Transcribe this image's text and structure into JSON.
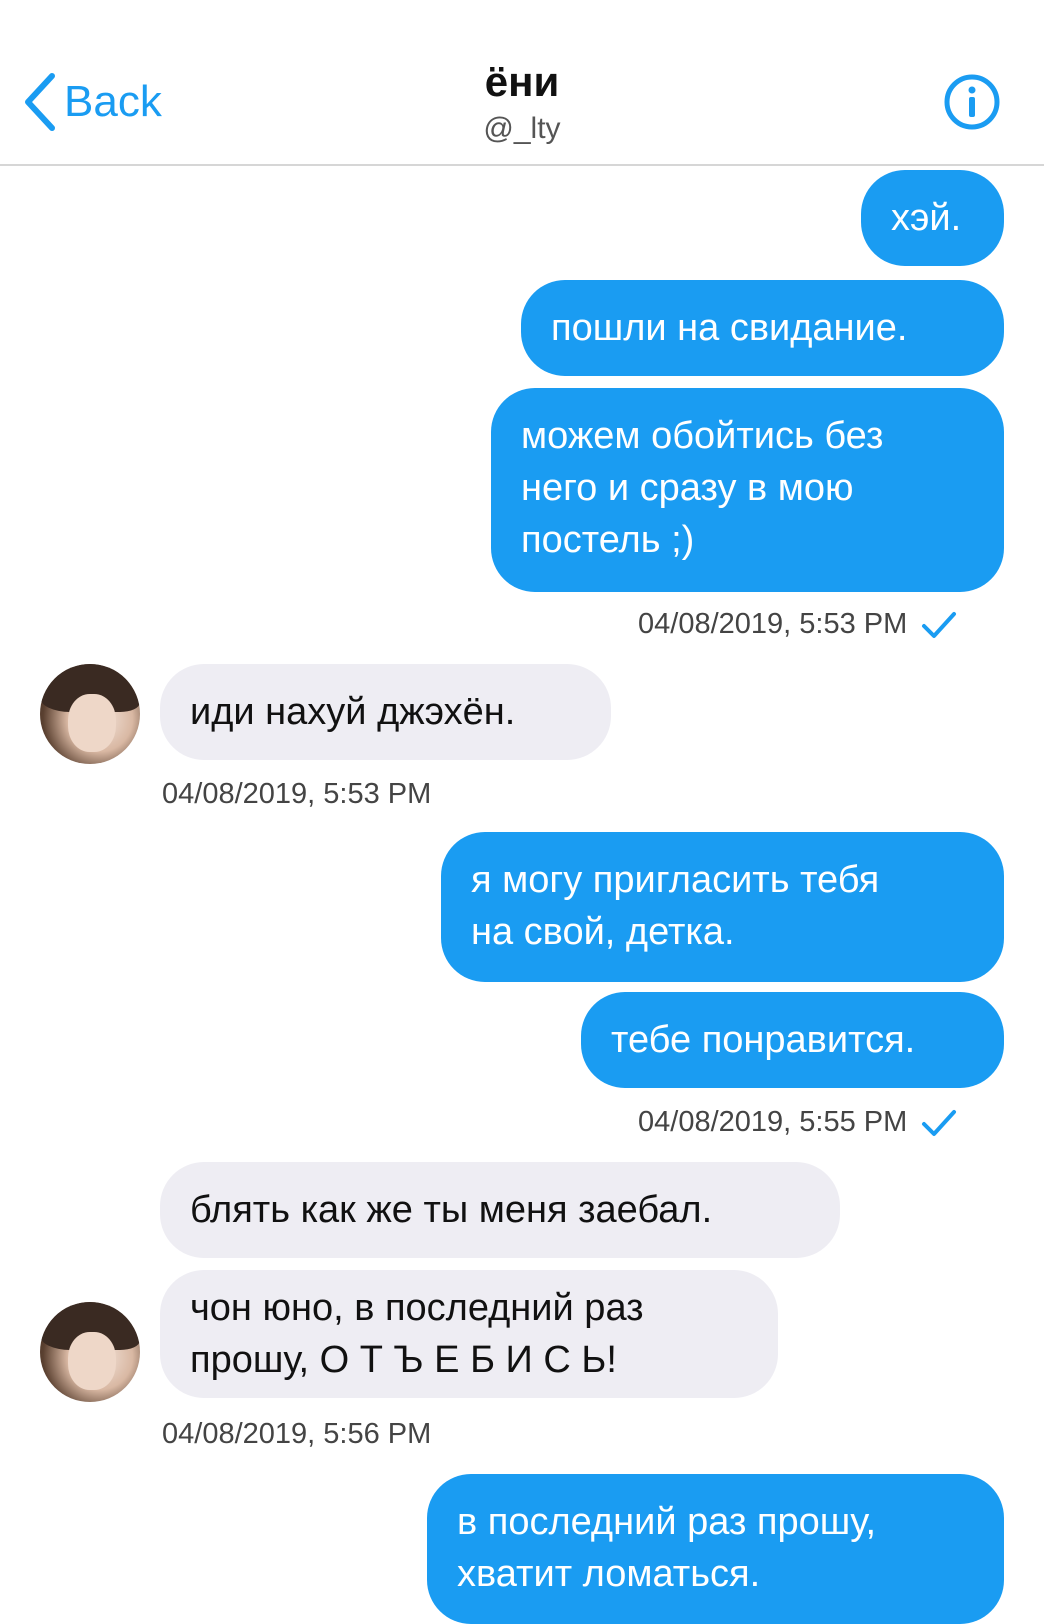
{
  "header": {
    "back_label": "Back",
    "name": "ёни",
    "handle": "@_lty",
    "info_icon": "info-icon"
  },
  "colors": {
    "accent": "#1a9cf2",
    "incoming_bubble": "#eeedf3",
    "outgoing_text": "#ffffff"
  },
  "messages": [
    {
      "text": "хэй."
    },
    {
      "text": "пошли на свидание."
    },
    {
      "text": "можем обойтись без\nнего и сразу в мою\nпостель ;)"
    },
    {
      "timestamp": "04/08/2019, 5:53 PM",
      "read": true
    },
    {
      "text": "иди нахуй джэхён."
    },
    {
      "timestamp": "04/08/2019, 5:53 PM"
    },
    {
      "text": "я могу пригласить тебя\nна свой, детка."
    },
    {
      "text": "тебе понравится."
    },
    {
      "timestamp": "04/08/2019, 5:55 PM",
      "read": true
    },
    {
      "text": "блять как же ты меня заебал."
    },
    {
      "text": "чон юно, в последний раз\nпрошу, О Т Ъ Е Б И С Ь!"
    },
    {
      "timestamp": "04/08/2019, 5:56 PM"
    },
    {
      "text": "в последний раз прошу,\nхватит ломаться."
    }
  ]
}
